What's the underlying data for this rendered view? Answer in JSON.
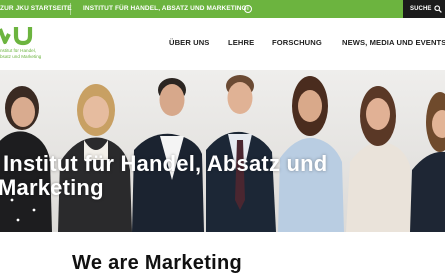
{
  "topbar": {
    "back_link": "ZUR JKU STARTSEITE",
    "institute_name": "INSTITUT FÜR HANDEL, ABSATZ UND MARKETING",
    "info_icon": "info-icon",
    "search_label": "SUCHE",
    "search_icon": "search-icon",
    "background_color": "#6cb43f"
  },
  "logo": {
    "line1": "nstitut für Handel,",
    "line2": "bsatz und Marketing",
    "color": "#6cb43f"
  },
  "nav": {
    "items": [
      {
        "label": "ÜBER UNS"
      },
      {
        "label": "LEHRE"
      },
      {
        "label": "FORSCHUNG"
      },
      {
        "label": "NEWS, MEDIA UND EVENTS"
      }
    ]
  },
  "hero": {
    "title_line1": "Institut für Handel, Absatz und",
    "title_line2": "Marketing"
  },
  "main": {
    "section_title": "We are Marketing"
  }
}
